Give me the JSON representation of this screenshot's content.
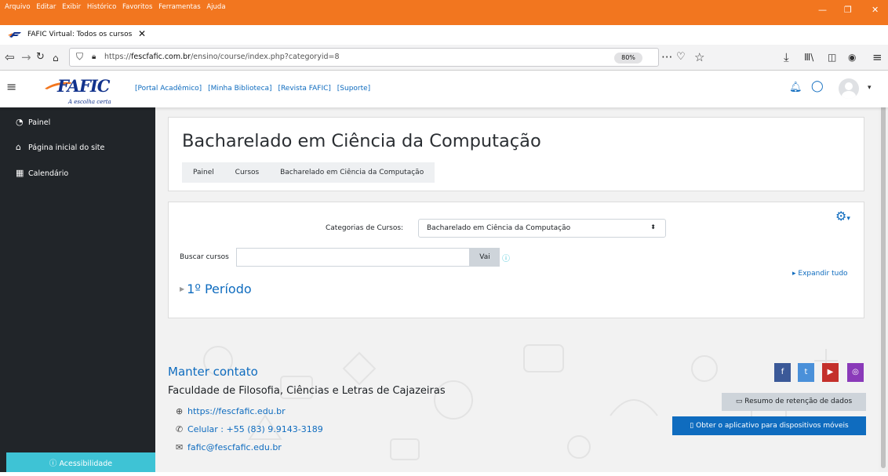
{
  "browser": {
    "menus": [
      "Arquivo",
      "Editar",
      "Exibir",
      "Histórico",
      "Favoritos",
      "Ferramentas",
      "Ajuda"
    ],
    "tab_title": "FAFIC Virtual: Todos os cursos",
    "url_prefix": "https://",
    "url_host": "fescfafic.com.br",
    "url_path": "/ensino/course/index.php?categoryid=8",
    "zoom": "80%"
  },
  "header": {
    "logo_text": "FAFIC",
    "logo_tagline": "A escolha certa",
    "links": [
      "[Portal Acadêmico]",
      "[Minha Biblioteca]",
      "[Revista FAFIC]",
      "[Suporte]"
    ]
  },
  "drawer": {
    "items": [
      {
        "label": "Painel",
        "icon": "dashboard-icon"
      },
      {
        "label": "Página inicial do site",
        "icon": "home-icon"
      },
      {
        "label": "Calendário",
        "icon": "calendar-icon"
      }
    ],
    "accessibility": "Acessibilidade"
  },
  "page": {
    "title": "Bacharelado em Ciência da Computação",
    "breadcrumb": [
      "Painel",
      "Cursos",
      "Bacharelado em Ciência da Computação"
    ]
  },
  "category": {
    "label": "Categorias de Cursos:",
    "selected": "Bacharelado em Ciência da Computação",
    "search_label": "Buscar cursos",
    "search_value": "",
    "go_button": "Vai",
    "expand_all": "Expandir tudo",
    "section": "1º Período"
  },
  "footer": {
    "title": "Manter contato",
    "institution": "Faculdade de Filosofia, Ciências e Letras de Cajazeiras",
    "website": "https://fescfafic.edu.br",
    "phone": "Celular : +55 (83) 9.9143-3189",
    "email": "fafic@fescfafic.edu.br",
    "data_retention": "Resumo de retenção de dados",
    "mobile_app": "Obter o aplicativo para dispositivos móveis"
  },
  "colors": {
    "browser_bar": "#f2761f",
    "brand_blue": "#0f6cbf",
    "drawer_bg": "#212529",
    "accessibility": "#3ec3d5",
    "facebook": "#3b5998",
    "twitter": "#4a90d9",
    "youtube": "#c4302b",
    "instagram": "#8a3ab9"
  }
}
